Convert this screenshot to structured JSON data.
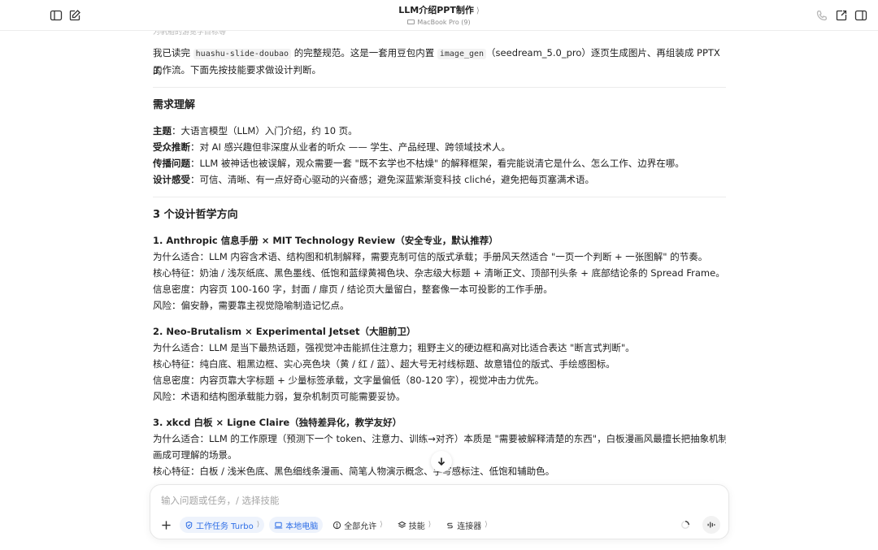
{
  "window": {
    "title": "LLM介绍PPT制作",
    "title_chevron": "⟩",
    "device": "MacBook Pro (9)"
  },
  "content": {
    "faded_line": "为帆船的游览学目标等",
    "intro_1_a": "我已读完 ",
    "intro_1_code_1": "huashu-slide-doubao",
    "intro_1_b": " 的完整规范。这是一套用豆包内置 ",
    "intro_1_code_2": "image_gen",
    "intro_1_c": "（seedream_5.0_pro）逐页生成图片、再组装成 PPTX 的",
    "intro_2": "工作流。下面先按技能要求做设计判断。",
    "req_heading": "需求理解",
    "req_items": [
      {
        "label": "主题",
        "text": "：大语言模型（LLM）入门介绍，约 10 页。"
      },
      {
        "label": "受众推断",
        "text": "：对 AI 感兴趣但非深度从业者的听众 —— 学生、产品经理、跨领域技术人。"
      },
      {
        "label": "传播问题",
        "text": "：LLM 被神话也被误解，观众需要一套 \"既不玄学也不枯燥\" 的解释框架，看完能说清它是什么、怎么工作、边界在哪。"
      },
      {
        "label": "设计感受",
        "text": "：可信、清晰、有一点好奇心驱动的兴奋感；避免深蓝紫渐变科技 cliché，避免把每页塞满术语。"
      }
    ],
    "dir_heading": "3 个设计哲学方向",
    "directions": [
      {
        "title": "1. Anthropic 信息手册 × MIT Technology Review（安全专业，默认推荐）",
        "lines": [
          "为什么适合：LLM 内容含术语、结构图和机制解释，需要克制可信的版式承载；手册风天然适合 \"一页一个判断 + 一张图解\" 的节奏。",
          "核心特征：奶油 / 浅灰纸底、黑色墨线、低饱和蓝绿黄褐色块、杂志级大标题 + 清晰正文、顶部刊头条 + 底部结论条的 Spread Frame。",
          "信息密度：内容页 100-160 字，封面 / 扉页 / 结论页大量留白，整套像一本可投影的工作手册。",
          "风险：偏安静，需要靠主视觉隐喻制造记忆点。"
        ]
      },
      {
        "title": "2. Neo-Brutalism × Experimental Jetset（大胆前卫）",
        "lines": [
          "为什么适合：LLM 是当下最热话题，强视觉冲击能抓住注意力；粗野主义的硬边框和高对比适合表达 \"断言式判断\"。",
          "核心特征：纯白底、粗黑边框、实心亮色块（黄 / 红 / 蓝）、超大号无衬线标题、故意错位的版式、手绘感图标。",
          "信息密度：内容页靠大字标题 + 少量标签承载，文字量偏低（80-120 字），视觉冲击力优先。",
          "风险：术语和结构图承载能力弱，复杂机制页可能需要妥协。"
        ]
      },
      {
        "title": "3. xkcd 白板 × Ligne Claire（独特差异化，教学友好）",
        "lines": [
          "为什么适合：LLM 的工作原理（预测下一个 token、注意力、训练→对齐）本质是 \"需要被解释清楚的东西\"，白板漫画风最擅长把抽象机制",
          "画成可理解的场景。",
          "核心特征：白板 / 浅米色底、黑色细线条漫画、简笔人物演示概念、手写感标注、低饱和辅助色。"
        ]
      }
    ]
  },
  "composer": {
    "placeholder": "输入问题或任务，/ 选择技能",
    "chips": [
      {
        "label": "工作任务 Turbo",
        "chevron": "⟩",
        "icon": "task-icon"
      },
      {
        "label": "本地电脑",
        "chevron": "",
        "icon": "laptop-icon"
      },
      {
        "label": "全部允许",
        "chevron": "⟩",
        "icon": "permission-icon"
      },
      {
        "label": "技能",
        "chevron": "⟩",
        "icon": "skills-icon"
      },
      {
        "label": "连接器",
        "chevron": "⟩",
        "icon": "connector-icon"
      }
    ]
  },
  "colors": {
    "accent_blue": "#2e6ee6",
    "text": "#1f1f1f",
    "muted": "#8d8d8d"
  }
}
